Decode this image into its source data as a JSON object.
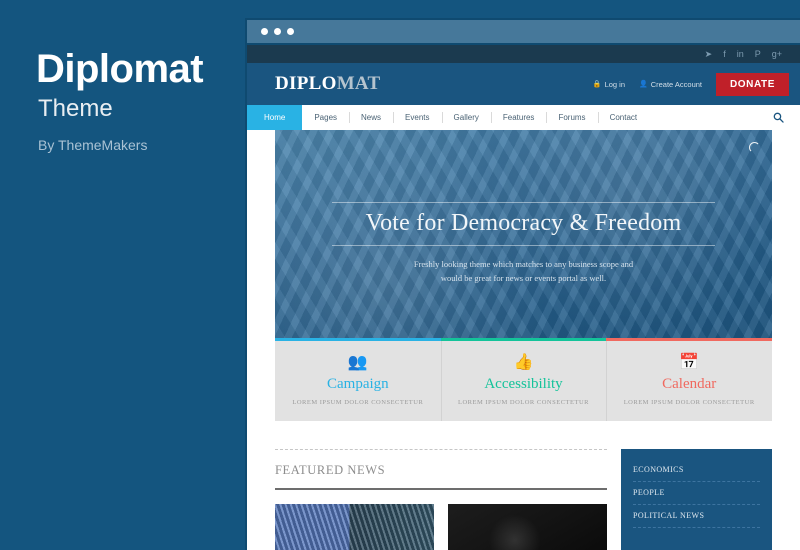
{
  "promo": {
    "title": "Diplomat",
    "subtitle": "Theme",
    "byline": "By ThemeMakers"
  },
  "colors": {
    "panel_blue": "#14557f",
    "header_blue": "#1a5580",
    "topbar_navy": "#1b3a4f",
    "accent_cyan": "#29b2e4",
    "accent_green": "#14c39a",
    "accent_red": "#f0695f",
    "donate_red": "#c02029",
    "chrome_blue": "#46789a",
    "feature_bg": "#e2e2e2"
  },
  "browser": {
    "chrome_dots": [
      "dot",
      "dot",
      "dot"
    ]
  },
  "site": {
    "social": [
      {
        "name": "twitter-icon",
        "glyph": "✔"
      },
      {
        "name": "facebook-icon",
        "glyph": "f"
      },
      {
        "name": "linkedin-icon",
        "glyph": "in"
      },
      {
        "name": "pinterest-icon",
        "glyph": "P"
      },
      {
        "name": "googleplus-icon",
        "glyph": "g+"
      }
    ],
    "logo": {
      "bold": "DIPLO",
      "light": "MAT"
    },
    "account": [
      {
        "label": "Log in",
        "icon": "lock-icon",
        "glyph": "▮"
      },
      {
        "label": "Create Account",
        "icon": "user-icon",
        "glyph": "▲"
      }
    ],
    "donate_label": "DONATE",
    "nav": [
      {
        "label": "Home",
        "active": true
      },
      {
        "label": "Pages",
        "active": false
      },
      {
        "label": "News",
        "active": false
      },
      {
        "label": "Events",
        "active": false
      },
      {
        "label": "Gallery",
        "active": false
      },
      {
        "label": "Features",
        "active": false
      },
      {
        "label": "Forums",
        "active": false
      },
      {
        "label": "Contact",
        "active": false
      }
    ],
    "search_icon": "⌕",
    "hero": {
      "title": "Vote for Democracy & Freedom",
      "subtitle_line1": "Freshly looking theme which matches to any business scope and",
      "subtitle_line2": "would be great for news or events portal as well."
    },
    "features": [
      {
        "title": "Campaign",
        "subtitle": "LOREM IPSUM DOLOR CONSECTETUR",
        "color": "#29b2e4",
        "icon_name": "group-icon",
        "glyph": "👥"
      },
      {
        "title": "Accessibility",
        "subtitle": "LOREM IPSUM DOLOR CONSECTETUR",
        "color": "#14c39a",
        "icon_name": "thumbs-up-icon",
        "glyph": "👍"
      },
      {
        "title": "Calendar",
        "subtitle": "LOREM IPSUM DOLOR CONSECTETUR",
        "color": "#f0695f",
        "icon_name": "calendar-icon",
        "glyph": "📅"
      }
    ],
    "featured_news_heading": "FEATURED NEWS",
    "sidebar_categories": [
      {
        "label": "ECONOMICS"
      },
      {
        "label": "PEOPLE"
      },
      {
        "label": "POLITICAL NEWS"
      }
    ]
  },
  "mobile": {
    "logo": {
      "bold": "DIPLO",
      "light": "MAT"
    },
    "hamburger_glyph": "☰",
    "donate_label": "DONATE",
    "header_icons": [
      {
        "name": "lock-icon",
        "glyph": "▮"
      },
      {
        "name": "user-icon",
        "glyph": "▲"
      }
    ],
    "hero_title": "Vote for Democracy & Freedom",
    "features": [
      {
        "title": "Campaign",
        "subtitle": "LOREM IPSUM DOLOR CONSECTETUR",
        "color": "#29b2e4",
        "icon_name": "group-icon",
        "glyph": "👥"
      },
      {
        "title": "Accessibility",
        "subtitle": "LOREM IPSUM DOLOR CONSECTETUR",
        "color": "#14c39a",
        "icon_name": "thumbs-up-icon",
        "glyph": "👍"
      }
    ]
  }
}
